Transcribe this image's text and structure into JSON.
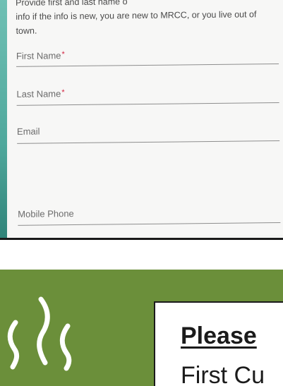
{
  "form": {
    "intro_lines": [
      "Provide first and last name o",
      "info if the info is new, you are new to MRCC, or you live out of",
      "town."
    ],
    "fields": {
      "first_name": {
        "label": "First Name",
        "required_mark": "*"
      },
      "last_name": {
        "label": "Last Name",
        "required_mark": "*"
      },
      "email": {
        "label": "Email"
      },
      "mobile_phone": {
        "label": "Mobile Phone"
      }
    }
  },
  "banner": {
    "title": "Please",
    "subtitle": "First Cu",
    "icon": "steam-icon",
    "colors": {
      "background": "#6b8f3a",
      "box": "#ffffff",
      "text": "#1b1b1b"
    }
  }
}
